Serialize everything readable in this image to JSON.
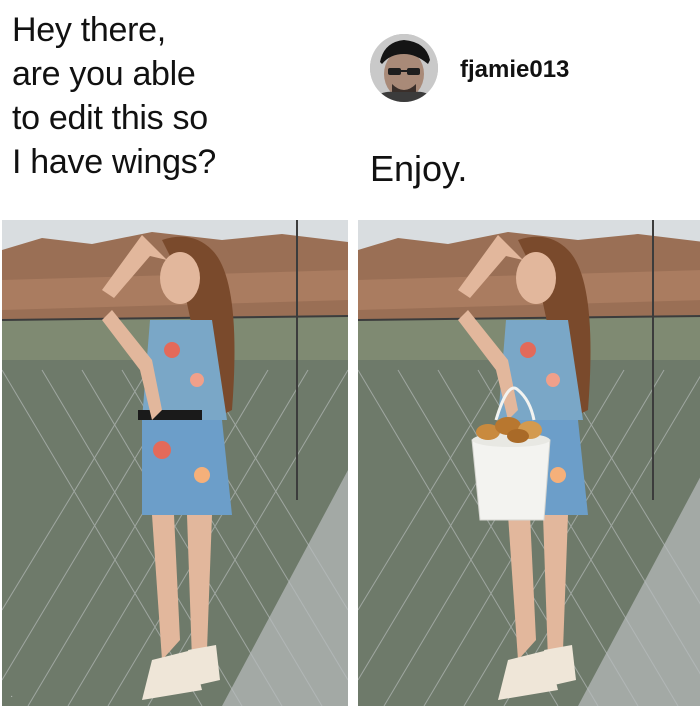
{
  "left_post": {
    "lines": [
      "Hey there,",
      "are you able",
      "to edit this so",
      "I have wings?"
    ]
  },
  "reply": {
    "username": "fjamie013",
    "text": "Enjoy."
  },
  "colors": {
    "text": "#111111",
    "sky": "#d9dde0",
    "cliff": "#9a6f55",
    "water": "#6e7a6a",
    "net": "#bfc3c6",
    "bucket": "#f3f3f0",
    "chicken": "#c98a3e"
  },
  "icons": {
    "avatar": "user-avatar-icon"
  }
}
